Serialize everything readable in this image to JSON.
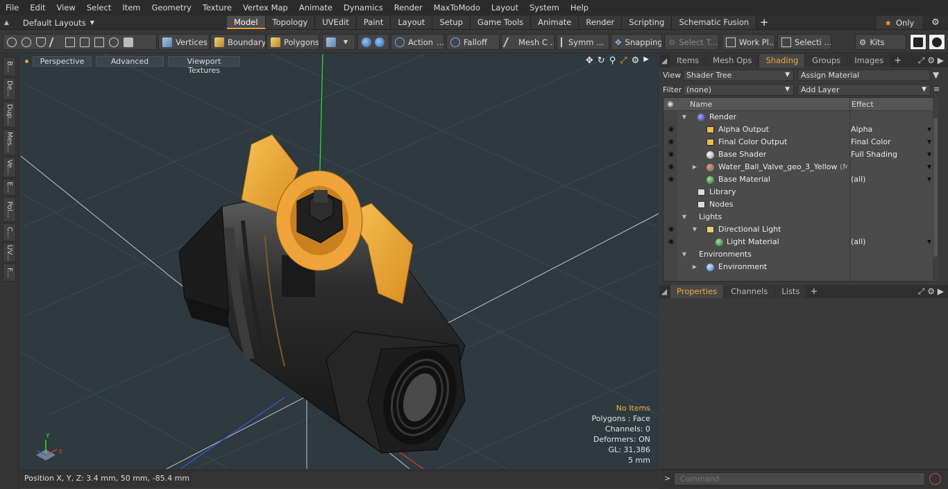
{
  "menu": [
    "File",
    "Edit",
    "View",
    "Select",
    "Item",
    "Geometry",
    "Texture",
    "Vertex Map",
    "Animate",
    "Dynamics",
    "Render",
    "MaxToModo",
    "Layout",
    "System",
    "Help"
  ],
  "layout_selector": "Default Layouts",
  "layout_tabs": [
    "Model",
    "Topology",
    "UVEdit",
    "Paint",
    "Layout",
    "Setup",
    "Game Tools",
    "Animate",
    "Render",
    "Scripting",
    "Schematic Fusion"
  ],
  "active_layout_tab": "Model",
  "only_label": "Only",
  "toolbar": {
    "vertices": "Vertices",
    "boundary": "Boundary",
    "polygons": "Polygons",
    "action": "Action",
    "falloff": "Falloff",
    "mesh": "Mesh C ...",
    "symmetry": "Symm ...",
    "snapping": "Snapping",
    "select_t": "Select T...",
    "work_plane": "Work Pl...",
    "selection": "Selecti ...",
    "kits": "Kits"
  },
  "left_strip": [
    "B...",
    "De...",
    "Dup...",
    "Mes...",
    "Ve...",
    "E...",
    "Pol...",
    "C...",
    "UV...",
    "F..."
  ],
  "viewport": {
    "perspective": "Perspective",
    "advanced": "Advanced",
    "textures": "Viewport Textures",
    "info": {
      "no_items": "No Items",
      "polygons": "Polygons : Face",
      "channels": "Channels: 0",
      "deformers": "Deformers: ON",
      "gl": "GL: 31,386",
      "scale": "5 mm"
    },
    "axis_y": "Y",
    "axis_x": "X"
  },
  "status": {
    "position": "Position X, Y, Z:   3.4 mm, 50 mm, -85.4 mm"
  },
  "right_tabs": [
    "Items",
    "Mesh Ops",
    "Shading",
    "Groups",
    "Images"
  ],
  "active_right_tab": "Shading",
  "view_label": "View",
  "view_value": "Shader Tree",
  "assign_material": "Assign Material",
  "filter_label": "Filter",
  "filter_value": "(none)",
  "add_layer": "Add Layer",
  "tree_headers": {
    "name": "Name",
    "effect": "Effect"
  },
  "tree_rows": [
    {
      "name": "Render",
      "effect": "",
      "muted": ""
    },
    {
      "name": "Alpha Output",
      "effect": "Alpha",
      "muted": ""
    },
    {
      "name": "Final Color Output",
      "effect": "Final Color",
      "muted": ""
    },
    {
      "name": "Base Shader",
      "effect": "Full Shading",
      "muted": ""
    },
    {
      "name": "Water_Ball_Valve_geo_3_Yellow",
      "effect": "",
      "muted": " (Ma..."
    },
    {
      "name": "Base Material",
      "effect": "(all)",
      "muted": ""
    },
    {
      "name": "Library",
      "effect": "",
      "muted": ""
    },
    {
      "name": "Nodes",
      "effect": "",
      "muted": ""
    },
    {
      "name": "Lights",
      "effect": "",
      "muted": ""
    },
    {
      "name": "Directional Light",
      "effect": "",
      "muted": ""
    },
    {
      "name": "Light Material",
      "effect": "(all)",
      "muted": ""
    },
    {
      "name": "Environments",
      "effect": "",
      "muted": ""
    },
    {
      "name": "Environment",
      "effect": "",
      "muted": ""
    }
  ],
  "props_tabs": [
    "Properties",
    "Channels",
    "Lists"
  ],
  "active_props_tab": "Properties",
  "command_placeholder": "Command",
  "colors": {
    "accent": "#e8a33b",
    "viewport_bg": "#2e3940",
    "valve_handle": "#f0a83a",
    "valve_body": "#2a2a2a"
  }
}
